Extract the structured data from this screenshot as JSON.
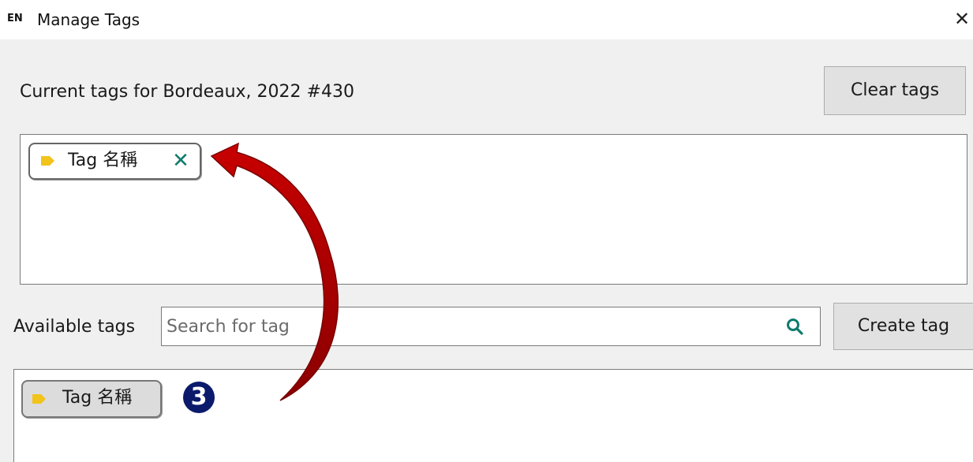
{
  "window": {
    "app_badge": "EN",
    "title": "Manage Tags",
    "close_glyph": "✕"
  },
  "current": {
    "label": "Current tags for Bordeaux, 2022 #430",
    "clear_button": "Clear tags",
    "tags": [
      {
        "label": "Tag 名稱",
        "remove_glyph": "✕",
        "icon": "tag-icon"
      }
    ]
  },
  "available": {
    "label": "Available tags",
    "search": {
      "placeholder": "Search for tag",
      "value": "",
      "icon": "search-icon"
    },
    "create_button": "Create tag",
    "tags": [
      {
        "label": "Tag 名稱",
        "icon": "tag-icon"
      }
    ]
  },
  "annotation": {
    "step_number": "3",
    "arrow_color": "#b00000",
    "badge_color": "#0c1a6b"
  },
  "colors": {
    "tag_yellow": "#f2c31b",
    "remove_teal": "#0f7b6c"
  }
}
